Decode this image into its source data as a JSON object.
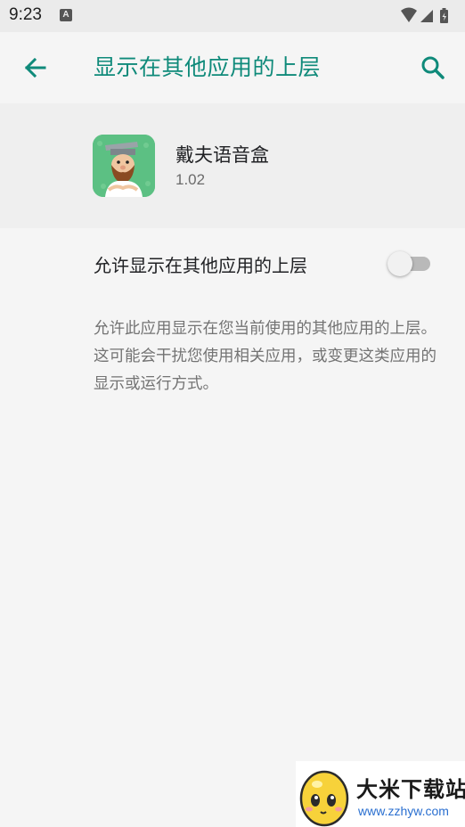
{
  "status_bar": {
    "time": "9:23",
    "notification_icon": "font-download-icon",
    "icons": [
      "wifi-icon",
      "signal-icon",
      "battery-charging-icon"
    ]
  },
  "toolbar": {
    "back_icon": "arrow-back-icon",
    "title": "显示在其他应用的上层",
    "search_icon": "search-icon",
    "accent_color": "#0f8a7a"
  },
  "app_header": {
    "app_name": "戴夫语音盒",
    "version": "1.02"
  },
  "permission": {
    "label": "允许显示在其他应用的上层",
    "enabled": false,
    "description": "允许此应用显示在您当前使用的其他应用的上层。这可能会干扰您使用相关应用，或变更这类应用的显示或运行方式。"
  },
  "watermark": {
    "title": "大米下载站",
    "url": "www.zzhyw.com"
  }
}
